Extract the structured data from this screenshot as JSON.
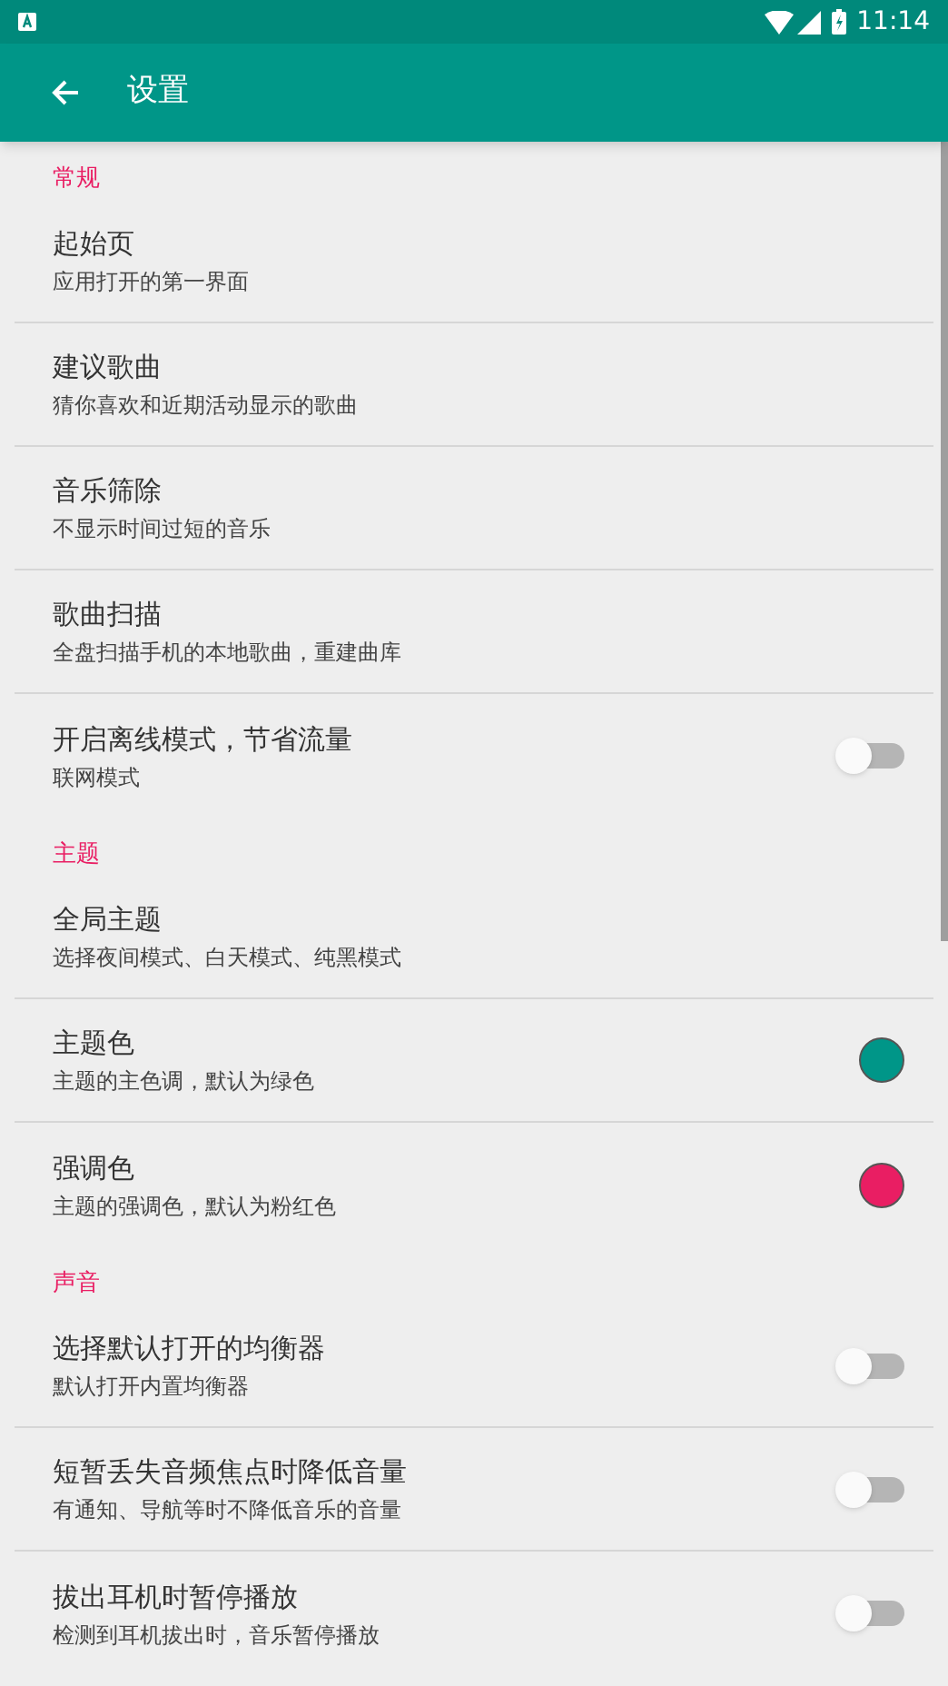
{
  "status_bar": {
    "time": "11:14"
  },
  "toolbar": {
    "title": "设置"
  },
  "sections": [
    {
      "header": "常规",
      "items": [
        {
          "kind": "text",
          "title": "起始页",
          "subtitle": "应用打开的第一界面"
        },
        {
          "kind": "text",
          "title": "建议歌曲",
          "subtitle": "猜你喜欢和近期活动显示的歌曲"
        },
        {
          "kind": "text",
          "title": "音乐筛除",
          "subtitle": "不显示时间过短的音乐"
        },
        {
          "kind": "text",
          "title": "歌曲扫描",
          "subtitle": "全盘扫描手机的本地歌曲，重建曲库"
        },
        {
          "kind": "switch",
          "title": "开启离线模式，节省流量",
          "subtitle": "联网模式",
          "on": false
        }
      ]
    },
    {
      "header": "主题",
      "items": [
        {
          "kind": "text",
          "title": "全局主题",
          "subtitle": "选择夜间模式、白天模式、纯黑模式"
        },
        {
          "kind": "color",
          "title": "主题色",
          "subtitle": "主题的主色调，默认为绿色",
          "color": "#009688"
        },
        {
          "kind": "color",
          "title": "强调色",
          "subtitle": "主题的强调色，默认为粉红色",
          "color": "#e91e63"
        }
      ]
    },
    {
      "header": "声音",
      "items": [
        {
          "kind": "switch",
          "title": "选择默认打开的均衡器",
          "subtitle": "默认打开内置均衡器",
          "on": false
        },
        {
          "kind": "switch",
          "title": "短暂丢失音频焦点时降低音量",
          "subtitle": "有通知、导航等时不降低音乐的音量",
          "on": false
        },
        {
          "kind": "switch",
          "title": "拔出耳机时暂停播放",
          "subtitle": "检测到耳机拔出时，音乐暂停播放",
          "on": false
        }
      ]
    }
  ]
}
